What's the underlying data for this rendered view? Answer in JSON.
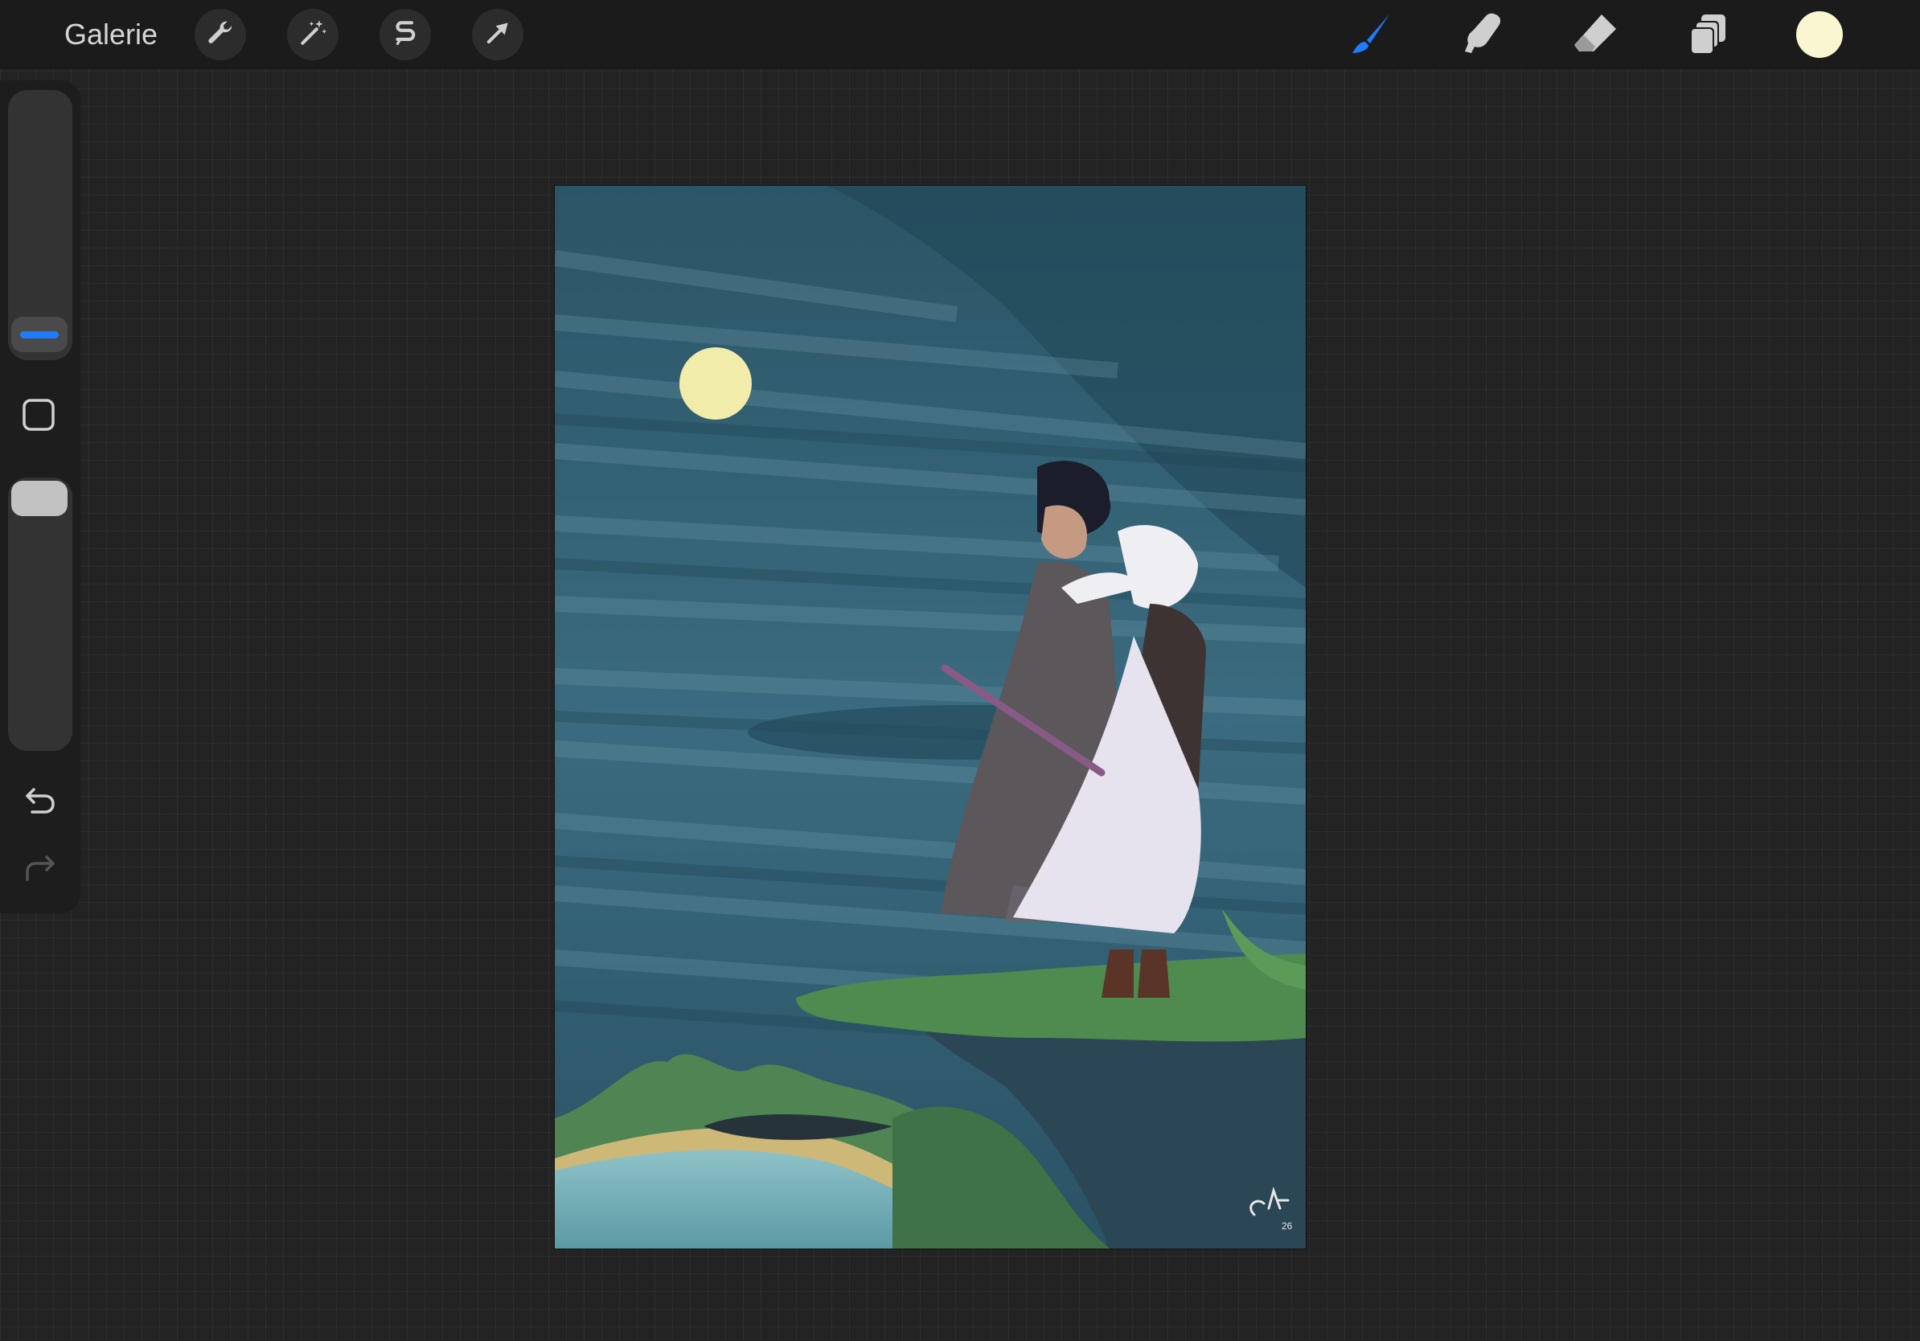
{
  "app": {
    "gallery_label": "Galerie"
  },
  "toolbar_left": [
    {
      "name": "actions-wrench-icon"
    },
    {
      "name": "adjustments-wand-icon"
    },
    {
      "name": "selection-s-icon"
    },
    {
      "name": "transform-arrow-icon"
    }
  ],
  "toolbar_right": [
    {
      "name": "brush-icon",
      "active": true
    },
    {
      "name": "smudge-icon",
      "active": false
    },
    {
      "name": "eraser-icon",
      "active": false
    },
    {
      "name": "layers-icon",
      "active": false
    }
  ],
  "colors": {
    "accent": "#1f7bff",
    "current_color": "#fbf6d2",
    "sky": "#2b5668",
    "moon": "#f2ecab"
  },
  "sidebar": {
    "brush_size_level": 0.16,
    "opacity_level": 0.06
  },
  "canvas": {
    "signature_text": "CM 26"
  }
}
